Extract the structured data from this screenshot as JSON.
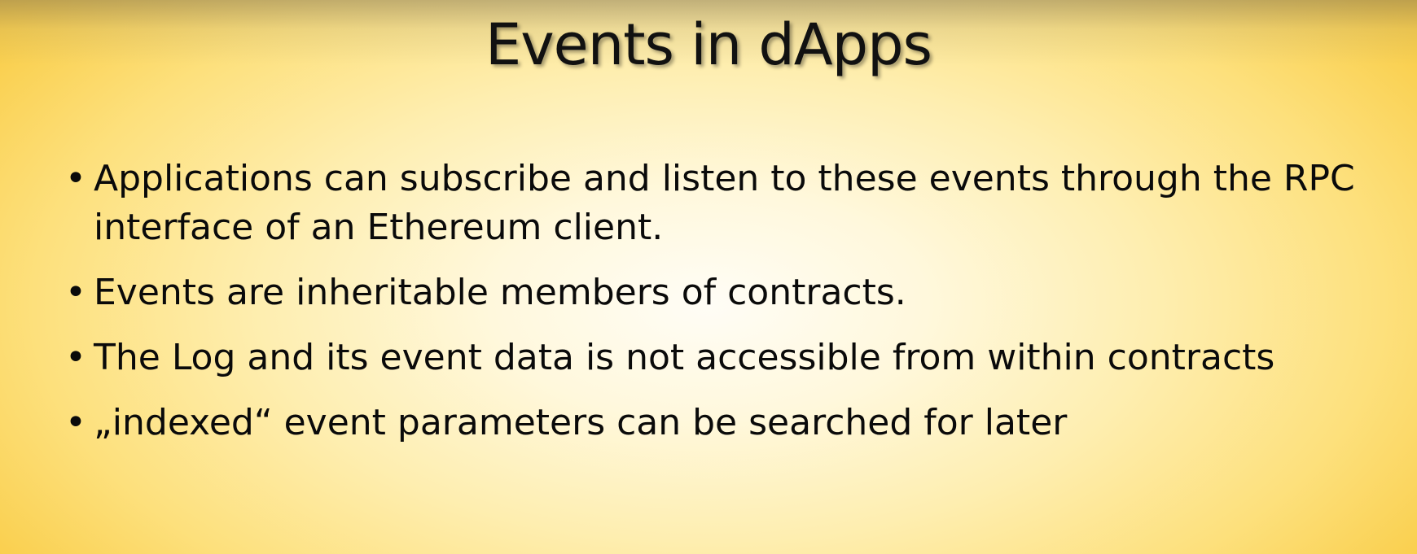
{
  "slide": {
    "title": "Events in dApps",
    "bullet_symbol": "•",
    "bullets": [
      "Applications can subscribe and listen to these events through the RPC interface of an Ethereum client.",
      "Events are inheritable members of contracts.",
      "The Log and its event data is not accessible from within contracts",
      "„indexed“ event parameters can be searched for later"
    ]
  }
}
